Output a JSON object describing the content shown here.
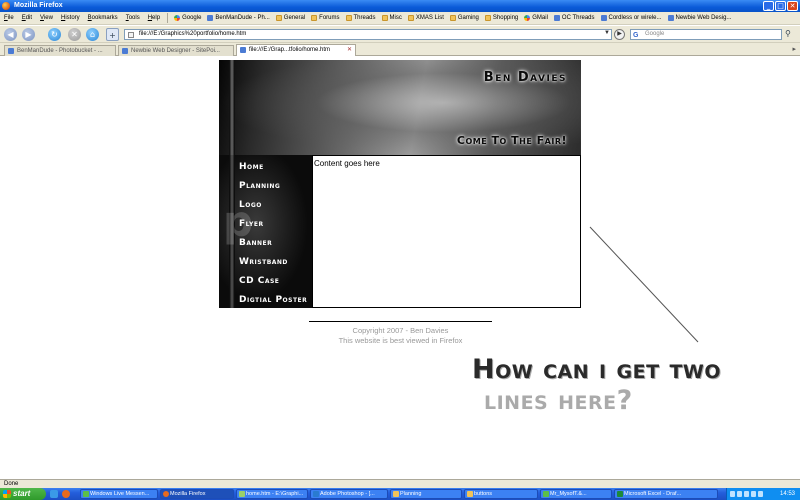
{
  "window": {
    "title": "Mozilla Firefox",
    "controls": [
      "_",
      "□",
      "✕"
    ]
  },
  "menu": [
    "File",
    "Edit",
    "View",
    "History",
    "Bookmarks",
    "Tools",
    "Help"
  ],
  "bookmarks": [
    {
      "label": "Google",
      "icon": "google-icon"
    },
    {
      "label": "BenManDude - Ph...",
      "icon": "page-icon"
    },
    {
      "label": "General",
      "icon": "folder-icon"
    },
    {
      "label": "Forums",
      "icon": "folder-icon"
    },
    {
      "label": "Threads",
      "icon": "folder-icon"
    },
    {
      "label": "Misc",
      "icon": "folder-icon"
    },
    {
      "label": "XMAS List",
      "icon": "folder-icon"
    },
    {
      "label": "Gaming",
      "icon": "folder-icon"
    },
    {
      "label": "Shopping",
      "icon": "folder-icon"
    },
    {
      "label": "GMail",
      "icon": "google-icon"
    },
    {
      "label": "OC Threads",
      "icon": "page-icon"
    },
    {
      "label": "Cordless or wirele...",
      "icon": "page-icon"
    },
    {
      "label": "Newbie Web Desig...",
      "icon": "page-icon"
    }
  ],
  "nav": {
    "url": "file:///E:/Graphics%20portfolio/home.htm",
    "search_placeholder": "Google"
  },
  "tabs": [
    {
      "label": "BenManDude - Photobucket - ...",
      "active": false
    },
    {
      "label": "Newbie Web Designer - SitePoi...",
      "active": false
    },
    {
      "label": "file:///E:/Grap...tfolio/home.htm",
      "active": true
    }
  ],
  "site": {
    "name": "Ben Davies",
    "tagline": "Come To The Fair!",
    "watermark": "p",
    "nav_items": [
      "Home",
      "Planning",
      "Logo",
      "Flyer",
      "Banner",
      "Wristband",
      "CD Case",
      "Digtial Poster"
    ],
    "content": "Content goes here",
    "footer_copyright": "Copyright 2007 - Ben Davies",
    "footer_note": "This website is best viewed in Firefox"
  },
  "annotation": {
    "line1": "How can i get two",
    "line2": "lines here?"
  },
  "status": "Done",
  "taskbar": {
    "start": "start",
    "tasks": [
      {
        "label": "Windows Live Messen...",
        "active": false
      },
      {
        "label": "Mozilla Firefox",
        "active": true
      },
      {
        "label": "home.htm - E:\\Graphi...",
        "active": false
      },
      {
        "label": "Adobe Photoshop - [...",
        "active": false
      },
      {
        "label": "Planning",
        "active": false
      },
      {
        "label": "buttons",
        "active": false
      },
      {
        "label": "Mr_MysofT.&...",
        "active": false
      },
      {
        "label": "Microsoft Excel - Draf...",
        "active": false
      }
    ],
    "clock": "14:53"
  }
}
